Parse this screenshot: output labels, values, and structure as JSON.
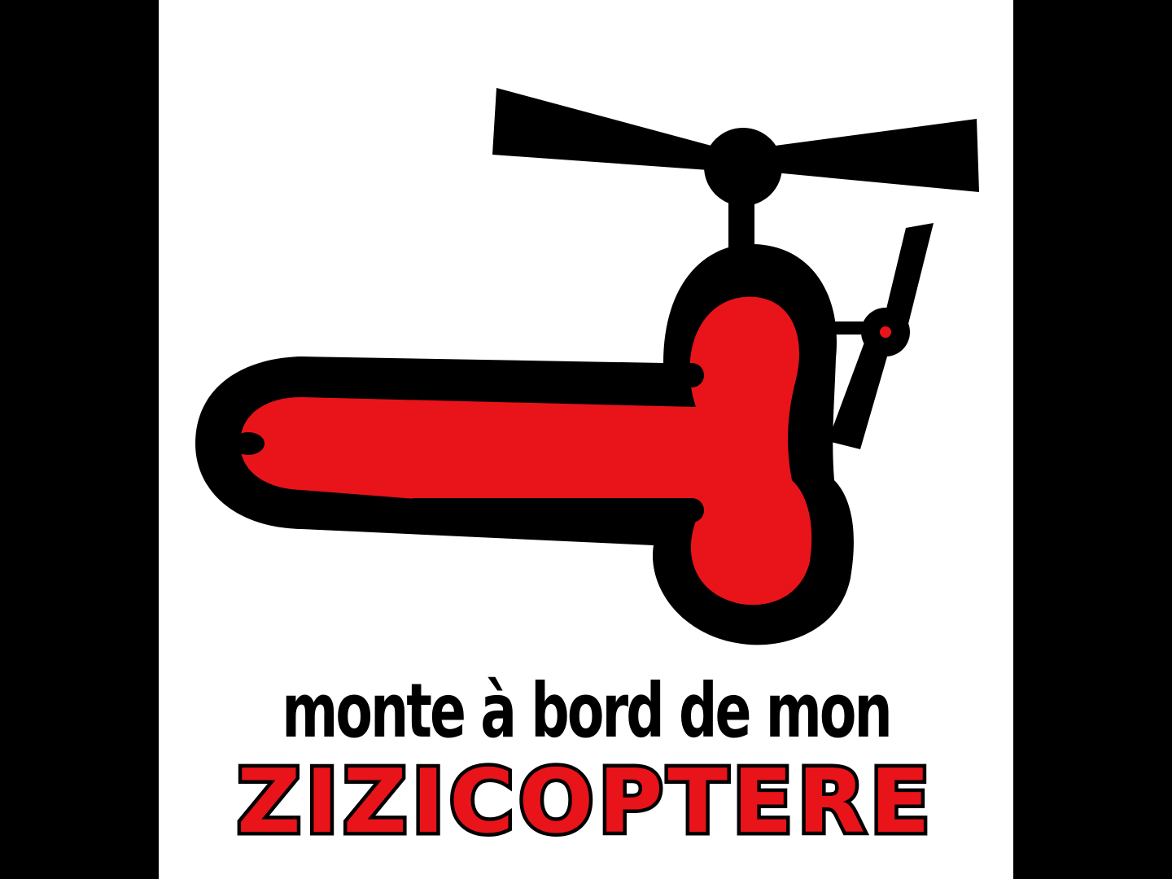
{
  "poster": {
    "tagline": "monte à bord de mon",
    "brand": "ZIZICOPTERE"
  },
  "colors": {
    "background": "#000000",
    "panel": "#ffffff",
    "ink": "#000000",
    "accent": "#e8141a"
  },
  "icons": {
    "main_figure": "zizicoptere-figure",
    "top_rotor": "rotor-icon",
    "tail_rotor": "tail-rotor-icon"
  }
}
